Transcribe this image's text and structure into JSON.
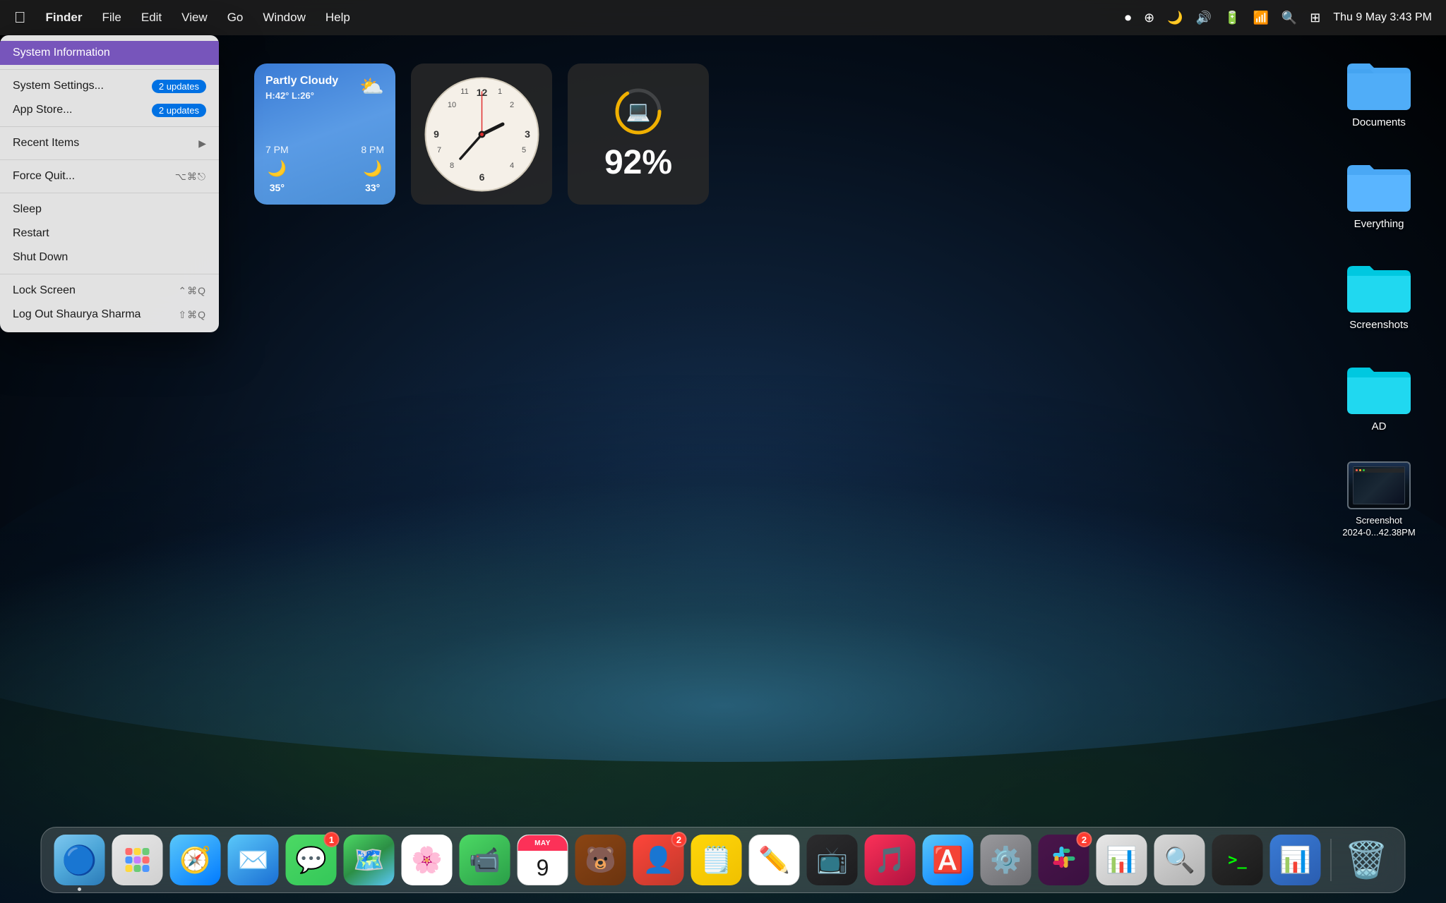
{
  "menubar": {
    "apple_label": "",
    "menus": [
      "Finder",
      "File",
      "Edit",
      "View",
      "Go",
      "Window",
      "Help"
    ],
    "right_icons": [
      "record",
      "accessibility",
      "darkmode",
      "volume",
      "battery",
      "wifi",
      "search",
      "control-center"
    ],
    "datetime": "Thu 9 May  3:43 PM"
  },
  "apple_menu": {
    "items": [
      {
        "id": "system-info",
        "label": "System Information",
        "shortcut": "",
        "badge": "",
        "submenu": false,
        "highlighted": true
      },
      {
        "id": "divider1",
        "type": "divider"
      },
      {
        "id": "system-settings",
        "label": "System Settings...",
        "badge": "2 updates",
        "submenu": false
      },
      {
        "id": "app-store",
        "label": "App Store...",
        "badge": "2 updates",
        "submenu": false
      },
      {
        "id": "divider2",
        "type": "divider"
      },
      {
        "id": "recent-items",
        "label": "Recent Items",
        "badge": "",
        "submenu": true
      },
      {
        "id": "divider3",
        "type": "divider"
      },
      {
        "id": "force-quit",
        "label": "Force Quit...",
        "shortcut": "⌥⌘⎋",
        "submenu": false
      },
      {
        "id": "divider4",
        "type": "divider"
      },
      {
        "id": "sleep",
        "label": "Sleep",
        "shortcut": "",
        "submenu": false
      },
      {
        "id": "restart",
        "label": "Restart",
        "shortcut": "",
        "submenu": false
      },
      {
        "id": "shutdown",
        "label": "Shut Down",
        "shortcut": "",
        "submenu": false
      },
      {
        "id": "divider5",
        "type": "divider"
      },
      {
        "id": "lock-screen",
        "label": "Lock Screen",
        "shortcut": "⌃⌘Q",
        "submenu": false
      },
      {
        "id": "logout",
        "label": "Log Out Shaurya Sharma",
        "shortcut": "⇧⌘Q",
        "submenu": false
      }
    ],
    "badges": {
      "system_settings": "2 updates",
      "app_store": "2 updates"
    }
  },
  "widgets": {
    "weather": {
      "condition": "Partly Cloudy",
      "high": "H:42°",
      "low": "L:26°",
      "forecast": [
        {
          "time": "7 PM",
          "icon": "🌙",
          "temp": "35°"
        },
        {
          "time": "8 PM",
          "icon": "🌙",
          "temp": "33°"
        }
      ]
    },
    "clock": {
      "hour": 3,
      "minute": 43,
      "second": 0
    },
    "battery": {
      "percent": "92%",
      "icon": "💻"
    }
  },
  "desktop_icons": [
    {
      "id": "documents",
      "label": "Documents",
      "color": "#4aa8f5",
      "type": "folder"
    },
    {
      "id": "everything",
      "label": "Everything",
      "color": "#4aa8f5",
      "type": "folder"
    },
    {
      "id": "screenshots",
      "label": "Screenshots",
      "color": "#00c8e0",
      "type": "folder"
    },
    {
      "id": "ad",
      "label": "AD",
      "color": "#00c8e0",
      "type": "folder"
    },
    {
      "id": "screenshot-file",
      "label": "Screenshot\n2024-0...42.38PM",
      "type": "file"
    }
  ],
  "dock": {
    "apps": [
      {
        "id": "finder",
        "label": "Finder",
        "emoji": "🔵",
        "class": "dock-finder",
        "dot": true,
        "badge": null
      },
      {
        "id": "launchpad",
        "label": "Launchpad",
        "emoji": "⠿",
        "class": "dock-launchpad",
        "dot": false,
        "badge": null
      },
      {
        "id": "safari",
        "label": "Safari",
        "emoji": "🧭",
        "class": "dock-safari",
        "dot": false,
        "badge": null
      },
      {
        "id": "mail",
        "label": "Mail",
        "emoji": "✉️",
        "class": "dock-mail",
        "dot": false,
        "badge": null
      },
      {
        "id": "messages",
        "label": "Messages",
        "emoji": "💬",
        "class": "dock-messages",
        "dot": false,
        "badge": "1"
      },
      {
        "id": "maps",
        "label": "Maps",
        "emoji": "🗺️",
        "class": "dock-maps",
        "dot": false,
        "badge": null
      },
      {
        "id": "photos",
        "label": "Photos",
        "emoji": "🌸",
        "class": "dock-photos",
        "dot": false,
        "badge": null
      },
      {
        "id": "facetime",
        "label": "FaceTime",
        "emoji": "📹",
        "class": "dock-facetime",
        "dot": false,
        "badge": null
      },
      {
        "id": "calendar",
        "label": "Calendar",
        "emoji": "📅",
        "class": "dock-calendar",
        "dot": false,
        "badge": null
      },
      {
        "id": "bear",
        "label": "Bear",
        "emoji": "🐻",
        "class": "dock-bear",
        "dot": false,
        "badge": null
      },
      {
        "id": "cardhop",
        "label": "Cardhop",
        "emoji": "👤",
        "class": "dock-cardhop",
        "dot": false,
        "badge": "2"
      },
      {
        "id": "notes",
        "label": "Notes",
        "emoji": "🗒️",
        "class": "dock-notes",
        "dot": false,
        "badge": null
      },
      {
        "id": "freeform",
        "label": "Freeform",
        "emoji": "✏️",
        "class": "dock-freeform",
        "dot": false,
        "badge": null
      },
      {
        "id": "appletv",
        "label": "Apple TV",
        "emoji": "📺",
        "class": "dock-appletv",
        "dot": false,
        "badge": null
      },
      {
        "id": "music",
        "label": "Music",
        "emoji": "🎵",
        "class": "dock-music",
        "dot": false,
        "badge": null
      },
      {
        "id": "appstore",
        "label": "App Store",
        "emoji": "🅰️",
        "class": "dock-appstore",
        "dot": false,
        "badge": null
      },
      {
        "id": "sysprefs",
        "label": "System Settings",
        "emoji": "⚙️",
        "class": "dock-sysprefs",
        "dot": false,
        "badge": null
      },
      {
        "id": "slack",
        "label": "Slack",
        "emoji": "💬",
        "class": "dock-slack",
        "dot": false,
        "badge": "2"
      },
      {
        "id": "activity",
        "label": "Activity Monitor",
        "emoji": "📊",
        "class": "dock-activity",
        "dot": false,
        "badge": null
      },
      {
        "id": "spotlight",
        "label": "Spotlight",
        "emoji": "🔍",
        "class": "dock-spotlight",
        "dot": false,
        "badge": null
      },
      {
        "id": "terminal",
        "label": "Terminal",
        "emoji": ">_",
        "class": "dock-terminal",
        "dot": false,
        "badge": null
      },
      {
        "id": "keynote",
        "label": "Keynote",
        "emoji": "📊",
        "class": "dock-keynote",
        "dot": false,
        "badge": null
      }
    ],
    "trash_label": "Trash"
  }
}
